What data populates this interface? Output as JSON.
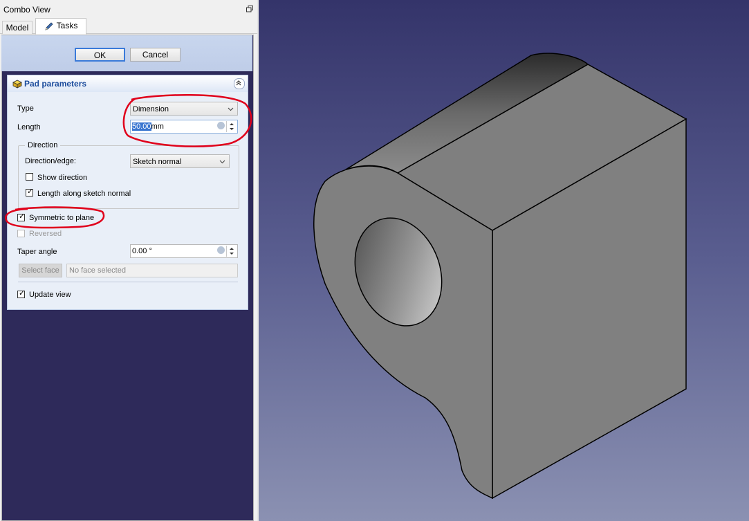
{
  "window": {
    "title": "Combo View"
  },
  "tabs": [
    {
      "label": "Model"
    },
    {
      "label": "Tasks"
    }
  ],
  "dialog": {
    "ok_label": "OK",
    "cancel_label": "Cancel"
  },
  "pad": {
    "title": "Pad parameters",
    "type_label": "Type",
    "type_value": "Dimension",
    "length_label": "Length",
    "length_value": "50.00",
    "length_unit": "mm",
    "direction": {
      "legend": "Direction",
      "edge_label": "Direction/edge:",
      "edge_value": "Sketch normal",
      "show_direction_label": "Show direction",
      "show_direction_checked": false,
      "length_along_label": "Length along sketch normal",
      "length_along_checked": true
    },
    "symmetric_label": "Symmetric to plane",
    "symmetric_checked": true,
    "reversed_label": "Reversed",
    "reversed_checked": false,
    "taper_label": "Taper angle",
    "taper_value": "0.00 °",
    "select_face_label": "Select face",
    "face_placeholder": "No face selected",
    "update_view_label": "Update view",
    "update_view_checked": true
  },
  "colors": {
    "annotation_red": "#e0001b",
    "viewport_top": "#34346a",
    "viewport_bottom": "#8b91b2",
    "selection_blue": "#3a76d0"
  }
}
